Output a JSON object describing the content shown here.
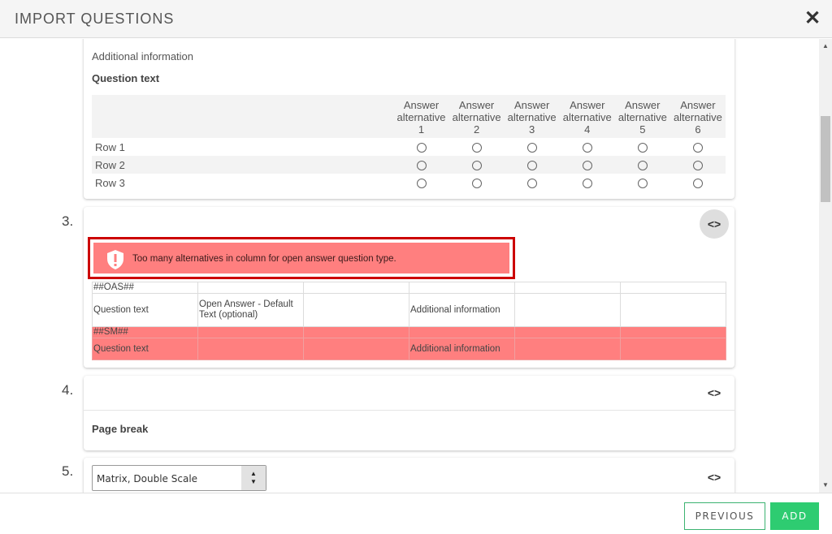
{
  "modal": {
    "title": "IMPORT QUESTIONS",
    "close_icon": "close-icon"
  },
  "question2": {
    "additional_info": "Additional information",
    "question_text": "Question text",
    "columns": [
      "Answer alternative 1",
      "Answer alternative 2",
      "Answer alternative 3",
      "Answer alternative 4",
      "Answer alternative 5",
      "Answer alternative 6"
    ],
    "rows": [
      "Row 1",
      "Row 2",
      "Row 3"
    ]
  },
  "question3": {
    "number": "3.",
    "code_icon": "code-icon",
    "error_message": "Too many alternatives in column for open answer question type.",
    "error_color": "#ff7f7f",
    "error_border_color": "#cc0000",
    "sheet": [
      [
        "##OAS##",
        "",
        "",
        "",
        "",
        ""
      ],
      [
        "Question text",
        "Open Answer - Default Text (optional)",
        "",
        "Additional information",
        "",
        ""
      ],
      [
        "##SM##",
        "",
        "",
        "",
        "",
        ""
      ],
      [
        "Question text",
        "",
        "",
        "Additional information",
        "",
        ""
      ]
    ]
  },
  "question4": {
    "number": "4.",
    "code_icon": "code-icon",
    "label": "Page break"
  },
  "question5": {
    "number": "5.",
    "code_icon": "code-icon",
    "type_select": "Matrix, Double Scale"
  },
  "footer": {
    "previous_label": "PREVIOUS",
    "add_label": "ADD",
    "accent_color": "#2ecc71"
  }
}
